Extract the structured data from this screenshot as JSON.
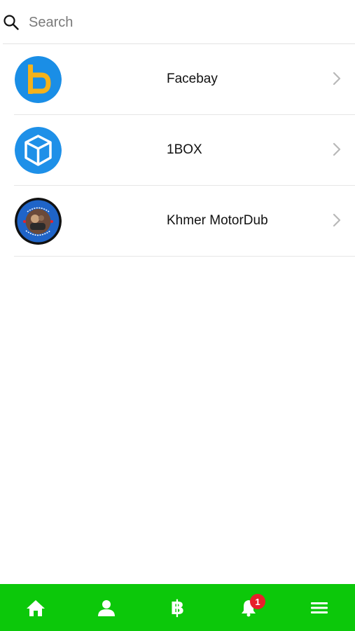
{
  "search": {
    "placeholder": "Search",
    "icon": "search-icon"
  },
  "list": {
    "items": [
      {
        "label": "Facebay",
        "logo_icon": "facebay-logo",
        "logo_color": "#1a8ee6",
        "accent_color": "#f5b21b"
      },
      {
        "label": "1BOX",
        "logo_icon": "box-logo",
        "logo_color": "#1e90e8"
      },
      {
        "label": "Khmer MotorDub",
        "logo_icon": "khmer-motordub-logo",
        "logo_color": "#1f64c8"
      }
    ]
  },
  "tab_bar": {
    "background": "#0cc80a",
    "tabs": [
      {
        "icon": "home-icon"
      },
      {
        "icon": "user-icon"
      },
      {
        "icon": "bitcoin-icon",
        "glyph": "฿"
      },
      {
        "icon": "bell-icon",
        "badge": "1"
      },
      {
        "icon": "menu-icon"
      }
    ],
    "badge_color": "#e8202b"
  }
}
